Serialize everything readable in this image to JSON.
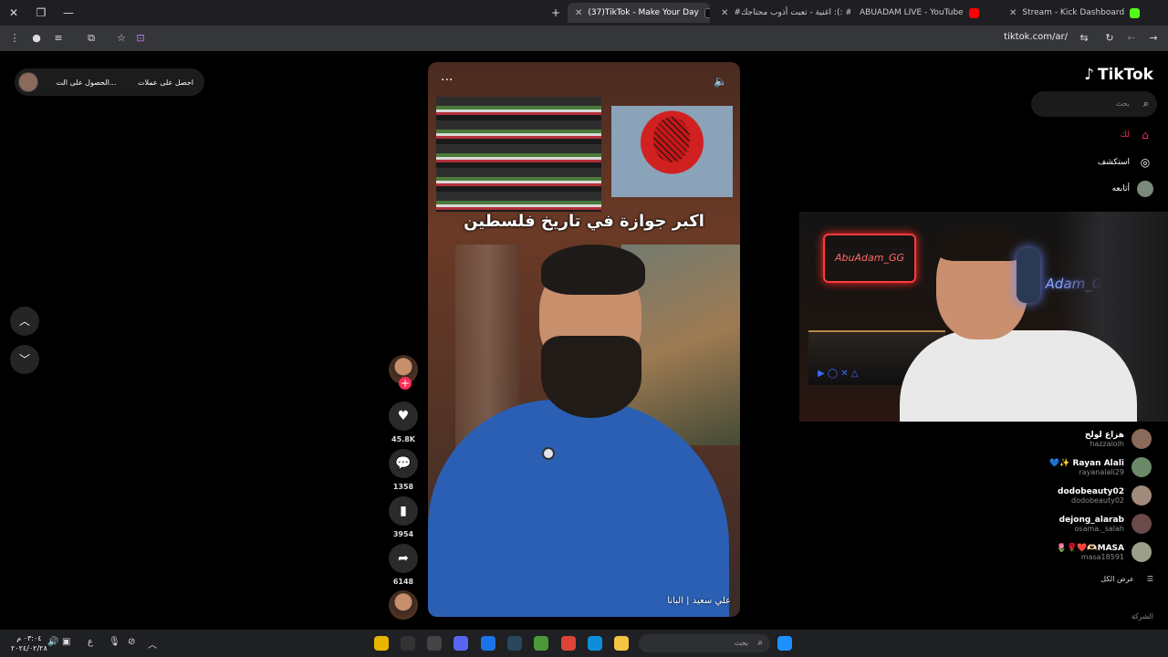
{
  "browser": {
    "tabs": [
      {
        "title": "(37)TikTok - Make Your Day",
        "active": true,
        "fav_color": "#111111"
      },
      {
        "title": "#اغنية - تعبت أذوب محتاجك :(: #",
        "active": false,
        "fav_color": "#ff0000"
      },
      {
        "title": "ABUADAM LIVE - YouTube",
        "active": false,
        "fav_color": "#ff0000"
      },
      {
        "title": "Stream - Kick Dashboard",
        "active": false,
        "fav_color": "#53fc18"
      }
    ],
    "url": "tiktok.com/ar/"
  },
  "coins": {
    "get_coins": "احصل على عملات",
    "get_app": "الحصول على الت..."
  },
  "video": {
    "headline": "اكبر جوازة في تاريخ فلسطين",
    "author": "علي سعيد | البانا",
    "more_glyph": "···",
    "sound_glyph": "🔈"
  },
  "actions": {
    "likes": "45.8K",
    "comments": "1358",
    "saves": "3954",
    "shares": "6148"
  },
  "sidebar": {
    "logo": "TikTok",
    "search_placeholder": "بحث",
    "nav": [
      {
        "label": "لك",
        "icon": "home-icon"
      },
      {
        "label": "استكشف",
        "icon": "compass-icon"
      },
      {
        "label": "أتابعه",
        "icon": "following-icon"
      }
    ],
    "following": [
      {
        "name": "هزاع لولح",
        "handle": "hazzalolh",
        "color": "#8a6a5a"
      },
      {
        "name": "Rayan Alali ✨💙",
        "handle": "rayanalali29",
        "color": "#6a8a6a"
      },
      {
        "name": "dodobeauty02",
        "handle": "dodobeauty02",
        "color": "#a08a7a"
      },
      {
        "name": "dejong_alarab",
        "handle": "osama._salah",
        "color": "#6a4a4a"
      },
      {
        "name": "MASA🫶🏻❤️🌹🌷",
        "handle": "masa18591",
        "color": "#9aa08a"
      }
    ],
    "see_all": "عرض الكل",
    "company": "الشركة"
  },
  "taskbar": {
    "search_placeholder": "بحث",
    "time": "٠٣:٠٤ م",
    "date": "٢٠٢٤/٠٢/٢٨",
    "lang": "ع"
  },
  "colors": {
    "accent": "#fe2c55",
    "bg": "#000000"
  }
}
